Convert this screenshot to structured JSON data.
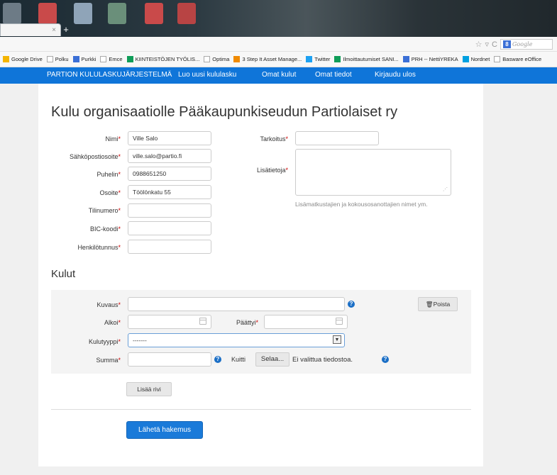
{
  "browser": {
    "taskbar_icons": [
      "computer-icon",
      "pdf-icon",
      "document-icon",
      "image-icon",
      "pdf-icon",
      "pdf-icon"
    ],
    "bookmarks": [
      {
        "label": "Google Drive",
        "icon": "google-drive-icon",
        "color": "#f4b400"
      },
      {
        "label": "Polku",
        "icon": "page-icon",
        "color": "#ffffff"
      },
      {
        "label": "Purkki",
        "icon": "purkki-icon",
        "color": "#3b6fd6"
      },
      {
        "label": "Emce",
        "icon": "page-icon",
        "color": "#ffffff"
      },
      {
        "label": "KIINTEISTÖJEN TYÖLIS...",
        "icon": "sheet-icon",
        "color": "#0f9d58"
      },
      {
        "label": "Optima",
        "icon": "page-icon",
        "color": "#ffffff"
      },
      {
        "label": "3 Step It Asset Manage...",
        "icon": "arc-icon",
        "color": "#f08a00"
      },
      {
        "label": "Twitter",
        "icon": "twitter-icon",
        "color": "#1da1f2"
      },
      {
        "label": "Ilmoittautumiset SANI...",
        "icon": "sheet-icon",
        "color": "#0f9d58"
      },
      {
        "label": "PRH -- NettiYREKA",
        "icon": "ie-icon",
        "color": "#3b6fd6"
      },
      {
        "label": "Nordnet",
        "icon": "nordnet-icon",
        "color": "#00a0e0"
      },
      {
        "label": "Basware eOffice",
        "icon": "page-icon",
        "color": "#ffffff"
      }
    ],
    "search_placeholder": "Google",
    "search_badge": "8"
  },
  "appnav": {
    "brand": "PARTION KULULASKUJÄRJESTELMÄ",
    "items": [
      "Luo uusi kululasku",
      "Omat kulut",
      "Omat tiedot",
      "Kirjaudu ulos"
    ]
  },
  "page": {
    "title": "Kulu organisaatiolle Pääkaupunkiseudun Partiolaiset ry",
    "required_mark": "*",
    "fields": {
      "nimi": {
        "label": "Nimi",
        "value": "Ville Salo"
      },
      "email": {
        "label": "Sähköpostiosoite",
        "value": "ville.salo@partio.fi"
      },
      "puhelin": {
        "label": "Puhelin",
        "value": "0988651250"
      },
      "osoite": {
        "label": "Osoite",
        "value": "Töölönkatu 55"
      },
      "tilinumero": {
        "label": "Tilinumero",
        "value": ""
      },
      "bic": {
        "label": "BIC-koodi",
        "value": ""
      },
      "henkilotunnus": {
        "label": "Henkilötunnus",
        "value": ""
      },
      "tarkoitus": {
        "label": "Tarkoitus",
        "value": ""
      },
      "lisatietoja": {
        "label": "Lisätietoja",
        "value": "",
        "hint": "Lisämatkustajien ja kokousosanottajien nimet ym."
      }
    },
    "costs_title": "Kulut",
    "cost_row": {
      "kuvaus_label": "Kuvaus",
      "alkoi_label": "Alkoi",
      "paattyi_label": "Päättyi",
      "kulutyyppi_label": "Kulutyyppi",
      "kulutyyppi_value": "-------",
      "summa_label": "Summa",
      "kuitti_label": "Kuitti",
      "browse_button": "Selaa...",
      "no_file_text": "Ei valittua tiedostoa.",
      "delete_button": "Poista"
    },
    "add_row_button": "Lisää rivi",
    "submit_button": "Lähetä hakemus"
  }
}
